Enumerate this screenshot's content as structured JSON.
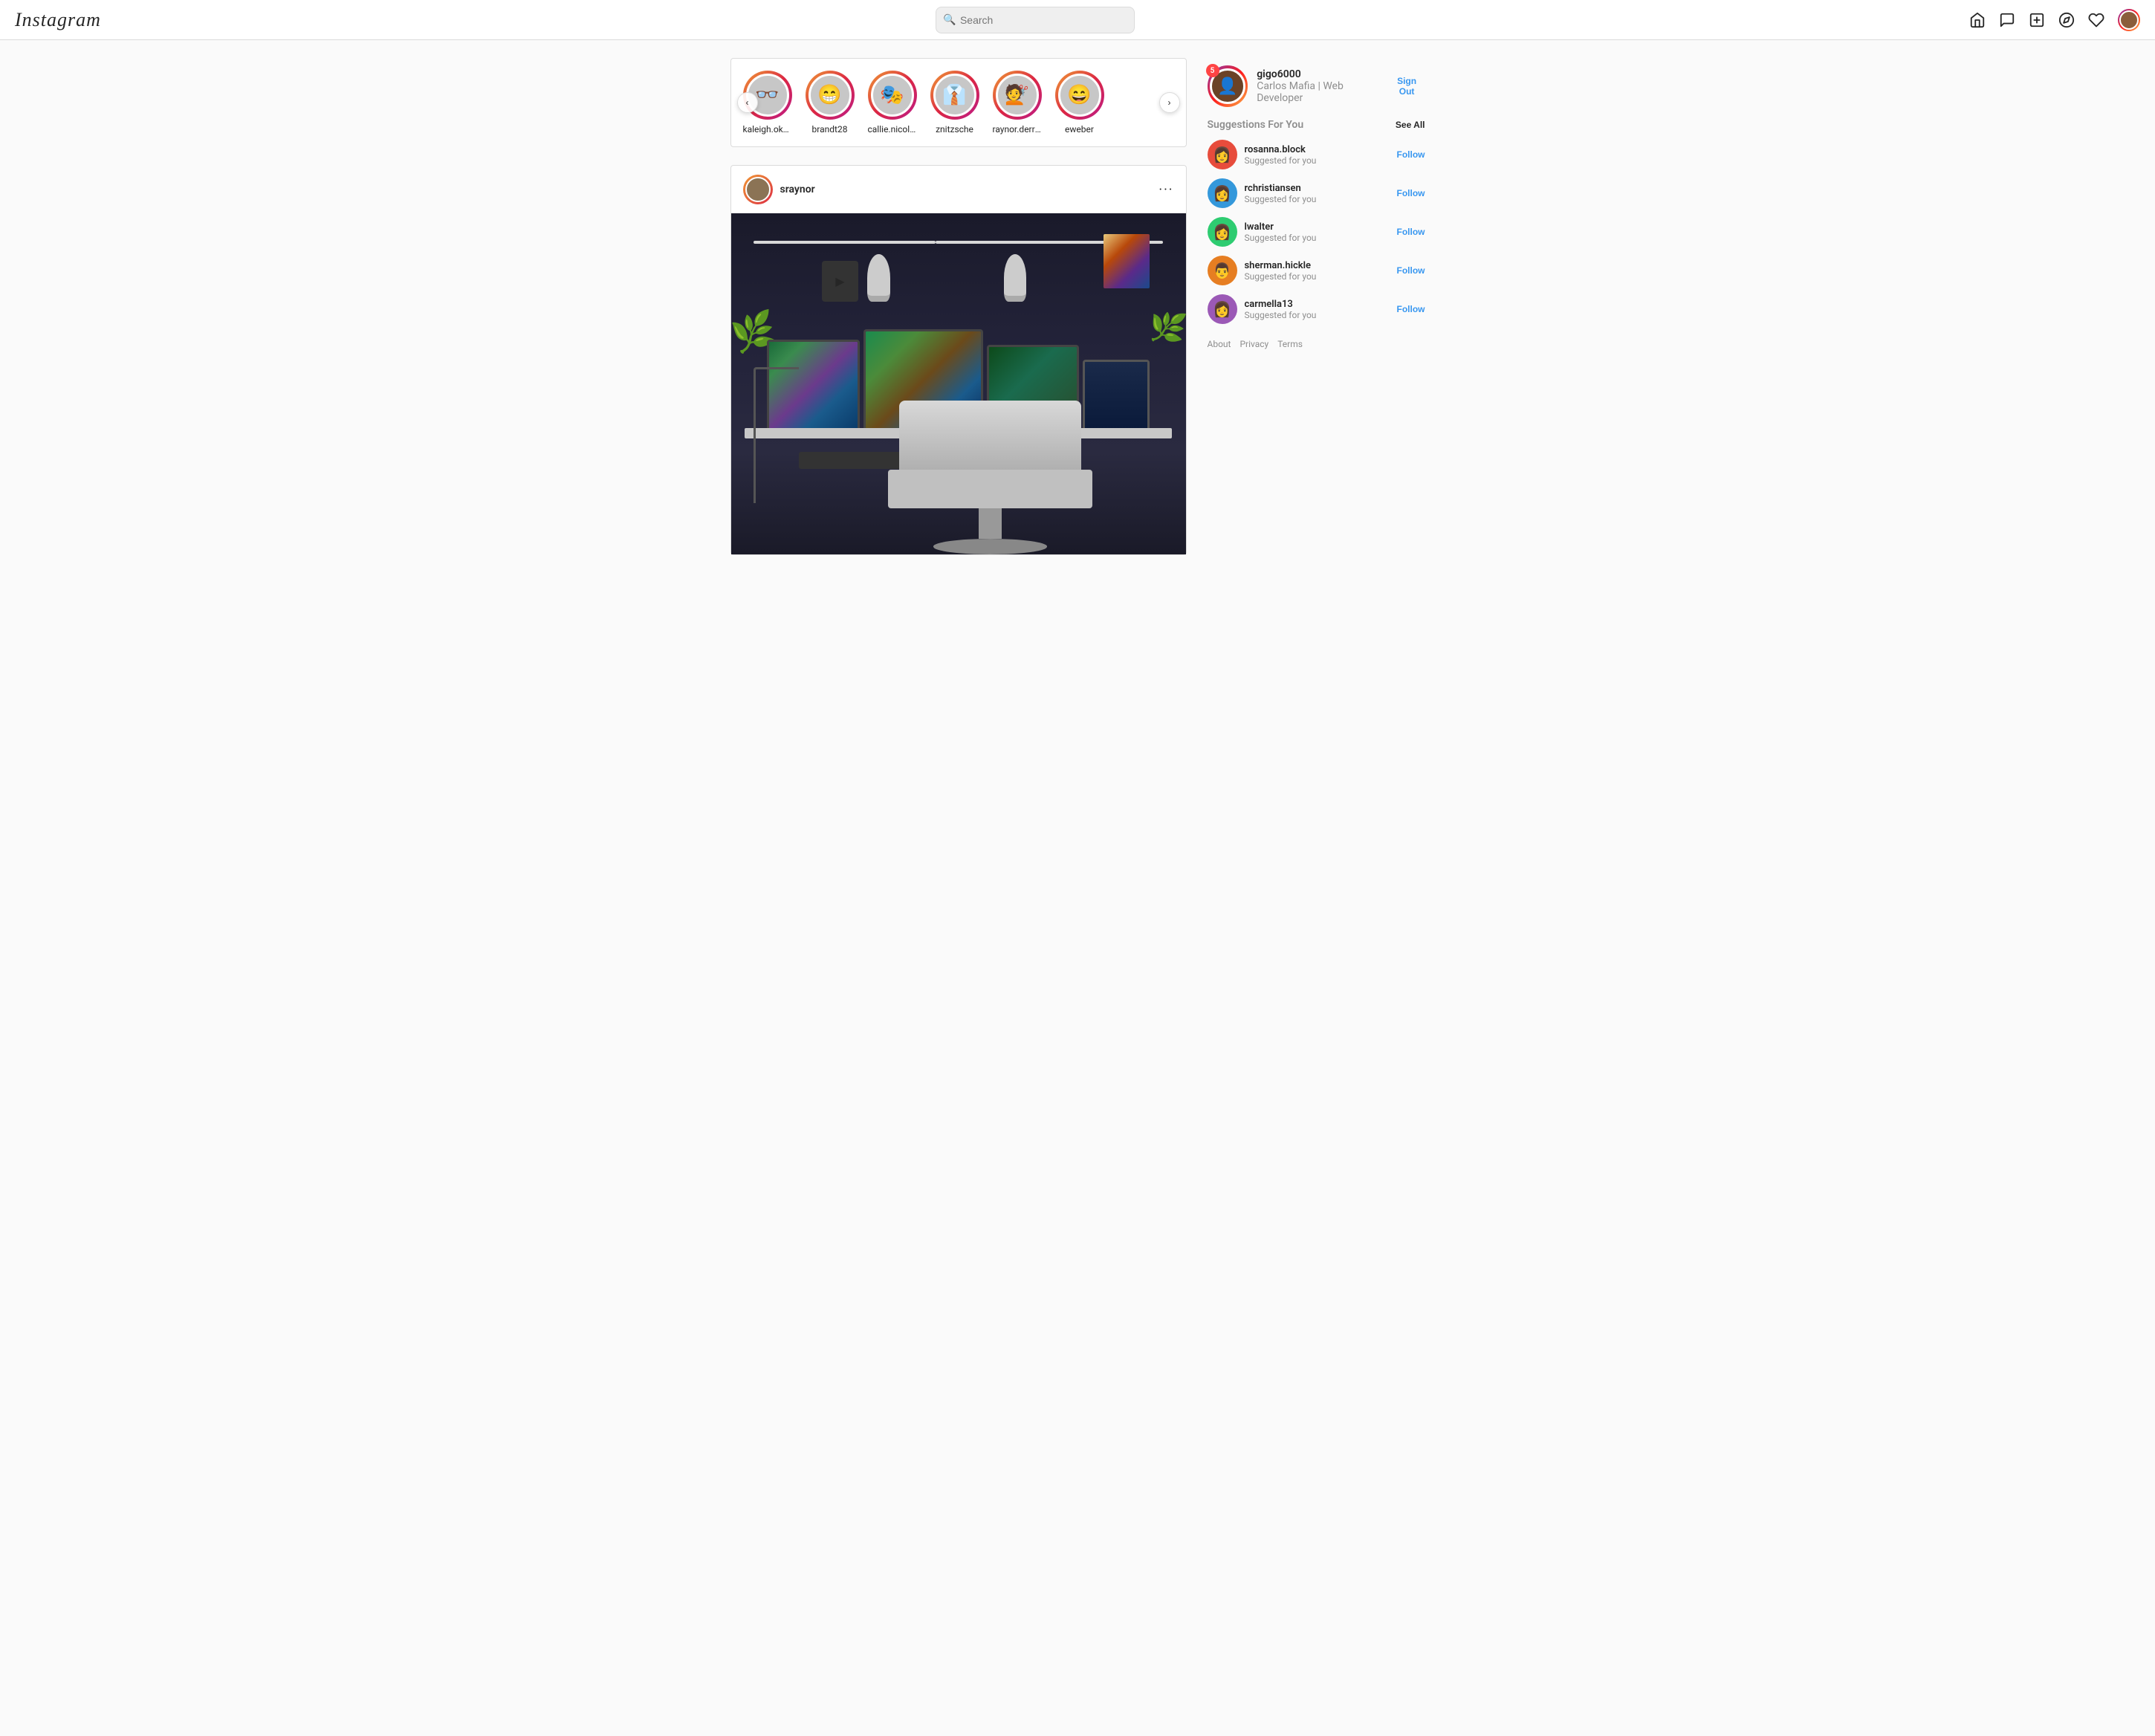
{
  "header": {
    "logo": "Instagram",
    "search": {
      "placeholder": "Search"
    },
    "nav": {
      "home_icon": "🏠",
      "message_icon": "💬",
      "add_icon": "➕",
      "compass_icon": "🧭",
      "heart_icon": "🤍",
      "profile_icon": "👤"
    }
  },
  "stories": {
    "prev_label": "‹",
    "next_label": "›",
    "items": [
      {
        "username": "kaleigh.oke...",
        "color": "sa-1",
        "emoji": "👓"
      },
      {
        "username": "brandt28",
        "color": "sa-2",
        "emoji": "😁"
      },
      {
        "username": "callie.nicolas",
        "color": "sa-3",
        "emoji": "🎭"
      },
      {
        "username": "znitzsche",
        "color": "sa-4",
        "emoji": "👔"
      },
      {
        "username": "raynor.derrick",
        "color": "sa-5",
        "emoji": "💇"
      },
      {
        "username": "eweber",
        "color": "sa-6",
        "emoji": "😄"
      }
    ]
  },
  "post": {
    "username": "sraynor",
    "more_icon": "···",
    "avatar_color": "sa-5"
  },
  "sidebar": {
    "profile": {
      "username": "gigo6000",
      "fullname": "Carlos Mafia | Web Developer",
      "badge_count": "5",
      "sign_out": "Sign Out"
    },
    "suggestions_title": "Suggestions For You",
    "see_all": "See All",
    "suggestions": [
      {
        "username": "rosanna.block",
        "sub": "Suggested for you",
        "follow": "Follow",
        "color": "sg-1",
        "emoji": "👩"
      },
      {
        "username": "rchristiansen",
        "sub": "Suggested for you",
        "follow": "Follow",
        "color": "sg-2",
        "emoji": "👩"
      },
      {
        "username": "lwalter",
        "sub": "Suggested for you",
        "follow": "Follow",
        "color": "sg-3",
        "emoji": "👩"
      },
      {
        "username": "sherman.hickle",
        "sub": "Suggested for you",
        "follow": "Follow",
        "color": "sg-4",
        "emoji": "👨"
      },
      {
        "username": "carmella13",
        "sub": "Suggested for you",
        "follow": "Follow",
        "color": "sg-5",
        "emoji": "👩"
      }
    ],
    "footer_links": [
      "About",
      "Privacy",
      "Terms"
    ]
  }
}
